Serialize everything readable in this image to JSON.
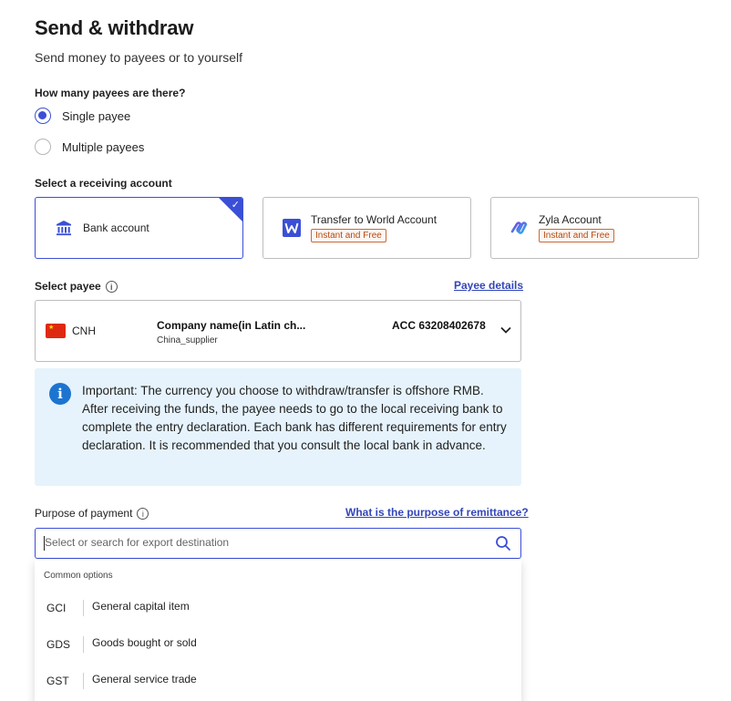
{
  "page": {
    "title": "Send & withdraw",
    "subtitle": "Send money to payees or to yourself"
  },
  "payees_question": {
    "label": "How many payees are there?",
    "options": [
      {
        "label": "Single payee",
        "checked": true
      },
      {
        "label": "Multiple payees",
        "checked": false
      }
    ]
  },
  "receiving_account": {
    "label": "Select a receiving account",
    "cards": [
      {
        "title": "Bank account",
        "icon": "bank-icon",
        "selected": true,
        "badge": ""
      },
      {
        "title": "Transfer to World Account",
        "icon": "world-w-icon",
        "selected": false,
        "badge": "Instant and Free"
      },
      {
        "title": "Zyla Account",
        "icon": "zyla-logo-icon",
        "selected": false,
        "badge": "Instant and Free"
      }
    ]
  },
  "select_payee": {
    "label": "Select payee",
    "details_link": "Payee details",
    "currency": "CNH",
    "flag": "china-flag-icon",
    "name": "Company name(in Latin ch...",
    "type": "China_supplier",
    "account": "ACC 63208402678"
  },
  "notice": {
    "text": "Important: The currency you choose to withdraw/transfer is offshore RMB. After receiving the funds, the payee needs to go to the local receiving bank to complete the entry declaration. Each bank has different requirements for entry declaration. It is recommended that you consult the local bank in advance."
  },
  "purpose": {
    "label": "Purpose of payment",
    "help_link": "What is the purpose of remittance?",
    "placeholder": "Select or search for export destination",
    "value": ""
  },
  "dropdown": {
    "header": "Common options",
    "options": [
      {
        "code": "GCI",
        "label": "General capital item"
      },
      {
        "code": "GDS",
        "label": "Goods bought or sold"
      },
      {
        "code": "GST",
        "label": "General service trade"
      }
    ]
  },
  "colors": {
    "accent": "#3b4fd6",
    "link": "#3346b8",
    "badge": "#b04a14",
    "notice_bg": "#e6f3fc",
    "notice_icon": "#1d74d0"
  }
}
